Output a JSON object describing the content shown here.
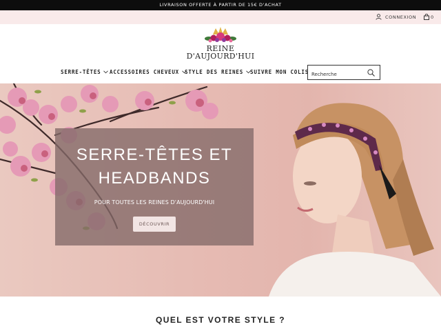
{
  "announcement": "LIVRAISON OFFERTE À PARTIR DE 15€ D'ACHAT",
  "utility": {
    "login_label": "CONNEXION",
    "cart_count": "0"
  },
  "logo": {
    "line1": "REINE",
    "line2": "D'AUJOURD'HUI"
  },
  "nav": {
    "items": [
      {
        "label": "SERRE-TÊTES",
        "dropdown": true
      },
      {
        "label": "ACCESSOIRES CHEVEUX",
        "dropdown": true
      },
      {
        "label": "STYLE DES REINES",
        "dropdown": true
      },
      {
        "label": "SUIVRE MON COLIS",
        "dropdown": false
      }
    ]
  },
  "search": {
    "placeholder": "Recherche",
    "icon": "search-icon"
  },
  "hero": {
    "title_line1": "SERRE-TÊTES ET",
    "title_line2": "HEADBANDS",
    "subtitle": "POUR TOUTES LES REINES D'AUJOURD'HUI",
    "button_label": "DÉCOUVRIR"
  },
  "section": {
    "title": "QUEL EST VOTRE STYLE ?"
  },
  "colors": {
    "announcement_bg": "#0d0d0d",
    "utility_bg": "#f9eaea",
    "hero_bg": "#e6bbb3",
    "overlay": "#836968"
  }
}
